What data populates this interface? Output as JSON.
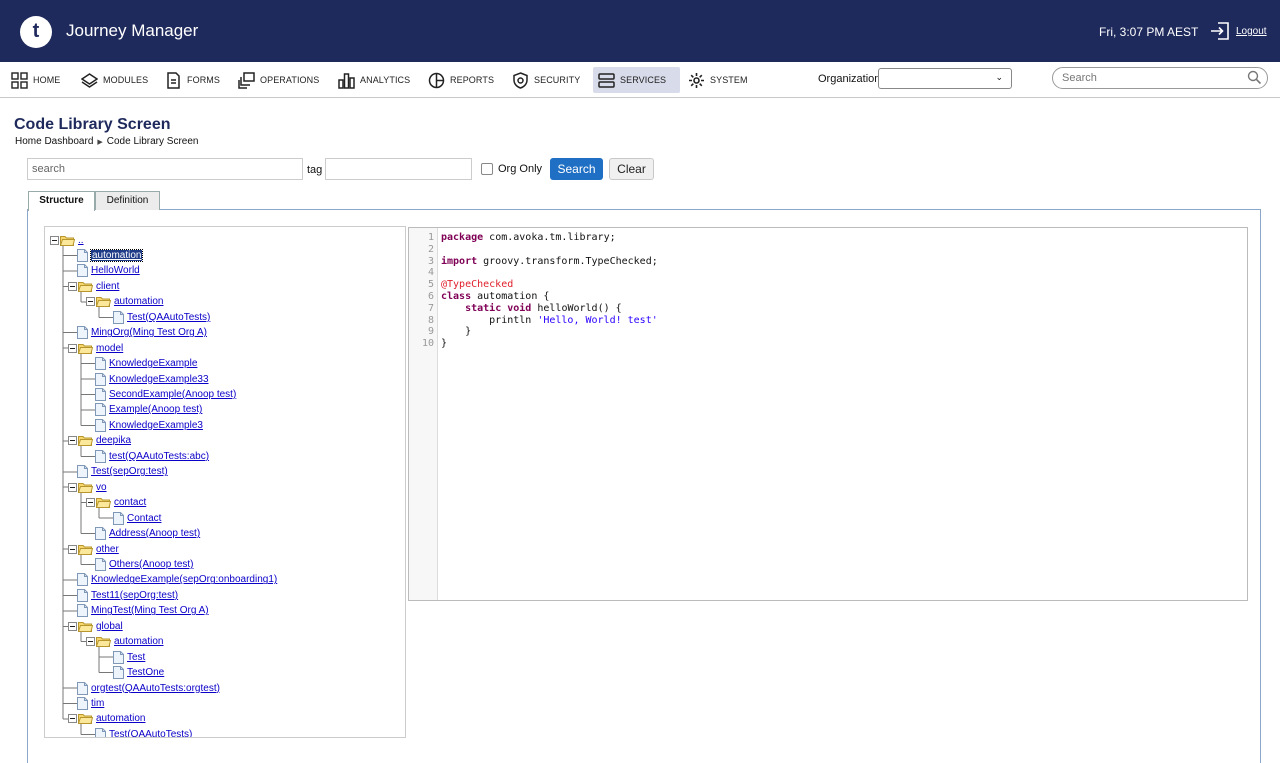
{
  "header": {
    "logo_letter": "t",
    "app_title": "Journey Manager",
    "datetime": "Fri, 3:07 PM AEST",
    "logout": "Logout"
  },
  "nav": {
    "items": [
      {
        "label": "HOME",
        "icon": "home-grid-icon"
      },
      {
        "label": "MODULES",
        "icon": "modules-icon"
      },
      {
        "label": "FORMS",
        "icon": "forms-icon"
      },
      {
        "label": "OPERATIONS",
        "icon": "operations-icon"
      },
      {
        "label": "ANALYTICS",
        "icon": "analytics-icon"
      },
      {
        "label": "REPORTS",
        "icon": "reports-icon"
      },
      {
        "label": "SECURITY",
        "icon": "security-icon"
      },
      {
        "label": "SERVICES",
        "icon": "services-icon",
        "active": true
      },
      {
        "label": "SYSTEM",
        "icon": "system-gear-icon"
      }
    ],
    "org_label": "Organization",
    "org_value": "",
    "search_placeholder": "Search"
  },
  "page": {
    "title": "Code Library Screen",
    "breadcrumb": [
      "Home Dashboard",
      "Code Library Screen"
    ]
  },
  "filters": {
    "search_placeholder": "search",
    "tag_label": "tag",
    "tag_value": "",
    "org_only_label": "Org Only",
    "org_only_checked": false,
    "search_button": "Search",
    "clear_button": "Clear"
  },
  "tabs": [
    {
      "label": "Structure",
      "active": true
    },
    {
      "label": "Definition",
      "active": false
    }
  ],
  "tree": [
    {
      "label": "..",
      "type": "folder",
      "depth": 0
    },
    {
      "label": "automation",
      "type": "file",
      "depth": 1,
      "selected": true
    },
    {
      "label": "HelloWorld",
      "type": "file",
      "depth": 1
    },
    {
      "label": "client",
      "type": "folder",
      "depth": 1
    },
    {
      "label": "automation",
      "type": "folder",
      "depth": 2
    },
    {
      "label": "Test(QAAutoTests)",
      "type": "file",
      "depth": 3
    },
    {
      "label": "MingOrg(Ming Test Org A)",
      "type": "file",
      "depth": 1
    },
    {
      "label": "model",
      "type": "folder",
      "depth": 1
    },
    {
      "label": "KnowledgeExample",
      "type": "file",
      "depth": 2
    },
    {
      "label": "KnowledgeExample33",
      "type": "file",
      "depth": 2
    },
    {
      "label": "SecondExample(Anoop test)",
      "type": "file",
      "depth": 2
    },
    {
      "label": "Example(Anoop test)",
      "type": "file",
      "depth": 2
    },
    {
      "label": "KnowledgeExample3",
      "type": "file",
      "depth": 2
    },
    {
      "label": "deepika",
      "type": "folder",
      "depth": 1
    },
    {
      "label": "test(QAAutoTests:abc)",
      "type": "file",
      "depth": 2
    },
    {
      "label": "Test(sepOrg:test)",
      "type": "file",
      "depth": 1
    },
    {
      "label": "vo",
      "type": "folder",
      "depth": 1
    },
    {
      "label": "contact",
      "type": "folder",
      "depth": 2
    },
    {
      "label": "Contact",
      "type": "file",
      "depth": 3
    },
    {
      "label": "Address(Anoop test)",
      "type": "file",
      "depth": 2
    },
    {
      "label": "other",
      "type": "folder",
      "depth": 1
    },
    {
      "label": "Others(Anoop test)",
      "type": "file",
      "depth": 2
    },
    {
      "label": "KnowledgeExample(sepOrg:onboarding1)",
      "type": "file",
      "depth": 1
    },
    {
      "label": "Test11(sepOrg:test)",
      "type": "file",
      "depth": 1
    },
    {
      "label": "MingTest(Ming Test Org A)",
      "type": "file",
      "depth": 1
    },
    {
      "label": "global",
      "type": "folder",
      "depth": 1
    },
    {
      "label": "automation",
      "type": "folder",
      "depth": 2
    },
    {
      "label": "Test",
      "type": "file",
      "depth": 3
    },
    {
      "label": "TestOne",
      "type": "file",
      "depth": 3
    },
    {
      "label": "orgtest(QAAutoTests:orgtest)",
      "type": "file",
      "depth": 1
    },
    {
      "label": "tim",
      "type": "file",
      "depth": 1
    },
    {
      "label": "automation",
      "type": "folder",
      "depth": 1
    },
    {
      "label": "Test(QAAutoTests)",
      "type": "file",
      "depth": 2
    }
  ],
  "code": {
    "lines": [
      [
        {
          "t": "package",
          "c": "kw"
        },
        {
          "t": " com.avoka.tm.library;",
          "c": ""
        }
      ],
      [],
      [
        {
          "t": "import",
          "c": "kw"
        },
        {
          "t": " groovy.transform.TypeChecked;",
          "c": ""
        }
      ],
      [],
      [
        {
          "t": "@TypeChecked",
          "c": "an"
        }
      ],
      [
        {
          "t": "class",
          "c": "kw"
        },
        {
          "t": " automation {",
          "c": ""
        }
      ],
      [
        {
          "t": "    ",
          "c": ""
        },
        {
          "t": "static",
          "c": "kw"
        },
        {
          "t": " ",
          "c": ""
        },
        {
          "t": "void",
          "c": "kw"
        },
        {
          "t": " helloWorld() {",
          "c": ""
        }
      ],
      [
        {
          "t": "        println ",
          "c": ""
        },
        {
          "t": "'Hello, World! test'",
          "c": "st"
        }
      ],
      [
        {
          "t": "    }",
          "c": ""
        }
      ],
      [
        {
          "t": "}",
          "c": ""
        }
      ]
    ]
  }
}
